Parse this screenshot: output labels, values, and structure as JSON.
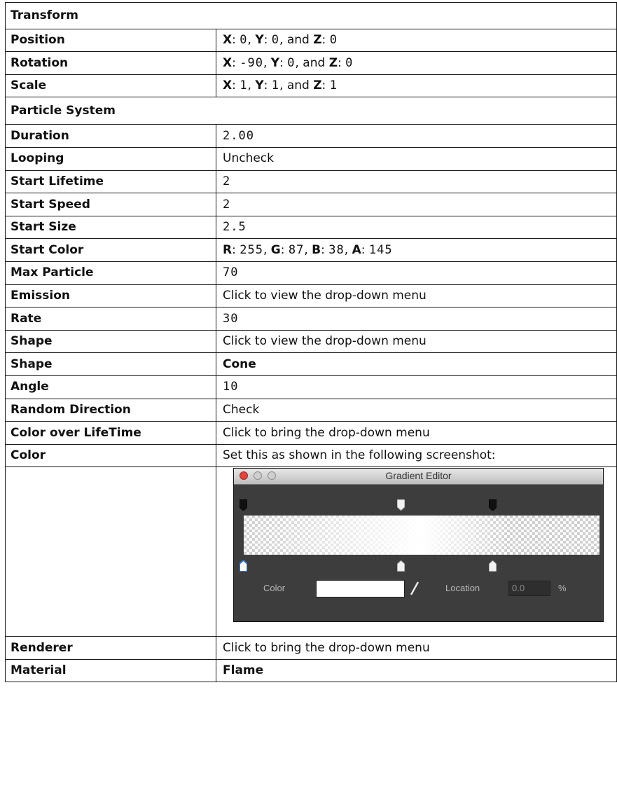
{
  "sections": {
    "transform": "Transform",
    "particle_system": "Particle System"
  },
  "transform_rows": [
    {
      "label": "Position",
      "x": "0",
      "y": "0",
      "z": "0"
    },
    {
      "label": "Rotation",
      "x": "-90",
      "y": "0",
      "z": "0"
    },
    {
      "label": "Scale",
      "x": "1",
      "y": "1",
      "z": "1"
    }
  ],
  "axis_labels": {
    "x": "X",
    "y": "Y",
    "z": "Z",
    "and": ", and "
  },
  "particle_rows": {
    "duration": {
      "label": "Duration",
      "value": "2.00"
    },
    "looping": {
      "label": "Looping",
      "value": "Uncheck"
    },
    "start_lifetime": {
      "label": "Start Lifetime",
      "value": "2"
    },
    "start_speed": {
      "label": "Start Speed",
      "value": "2"
    },
    "start_size": {
      "label": "Start Size",
      "value": "2.5"
    },
    "start_color": {
      "label": "Start Color",
      "r": "255",
      "g": "87",
      "b": "38",
      "a": "145",
      "r_key": "R",
      "g_key": "G",
      "b_key": "B",
      "a_key": "A"
    },
    "max_particle": {
      "label": "Max Particle",
      "value": "70"
    },
    "emission": {
      "label": "Emission",
      "value": "Click to view the drop-down menu"
    },
    "rate": {
      "label": "Rate",
      "value": "30"
    },
    "shape_menu": {
      "label": "Shape",
      "value": "Click to view the drop-down menu"
    },
    "shape": {
      "label": "Shape",
      "value": "Cone"
    },
    "angle": {
      "label": "Angle",
      "value": "10"
    },
    "random_direction": {
      "label": "Random Direction",
      "value": "Check"
    },
    "color_over_lifetime": {
      "label": "Color over LifeTime",
      "value": "Click to bring the drop-down menu"
    },
    "color": {
      "label": "Color",
      "value": "Set this as shown in the following screenshot:"
    },
    "renderer": {
      "label": "Renderer",
      "value": "Click to bring the drop-down menu"
    },
    "material": {
      "label": "Material",
      "value": "Flame"
    }
  },
  "gradient_editor": {
    "title": "Gradient Editor",
    "color_label": "Color",
    "location_label": "Location",
    "location_value": "0.0",
    "percent": "%",
    "swatch_color": "#ffffff",
    "close_color": "#e0453f",
    "bar_background": "#3d3d3d"
  }
}
